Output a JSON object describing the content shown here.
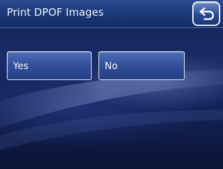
{
  "header": {
    "title": "Print DPOF Images",
    "back_icon": "return-arrow-icon"
  },
  "options": {
    "yes_label": "Yes",
    "no_label": "No"
  },
  "colors": {
    "header": "#1d3a7c",
    "button": "#34509a",
    "text": "#f3f6fb"
  }
}
